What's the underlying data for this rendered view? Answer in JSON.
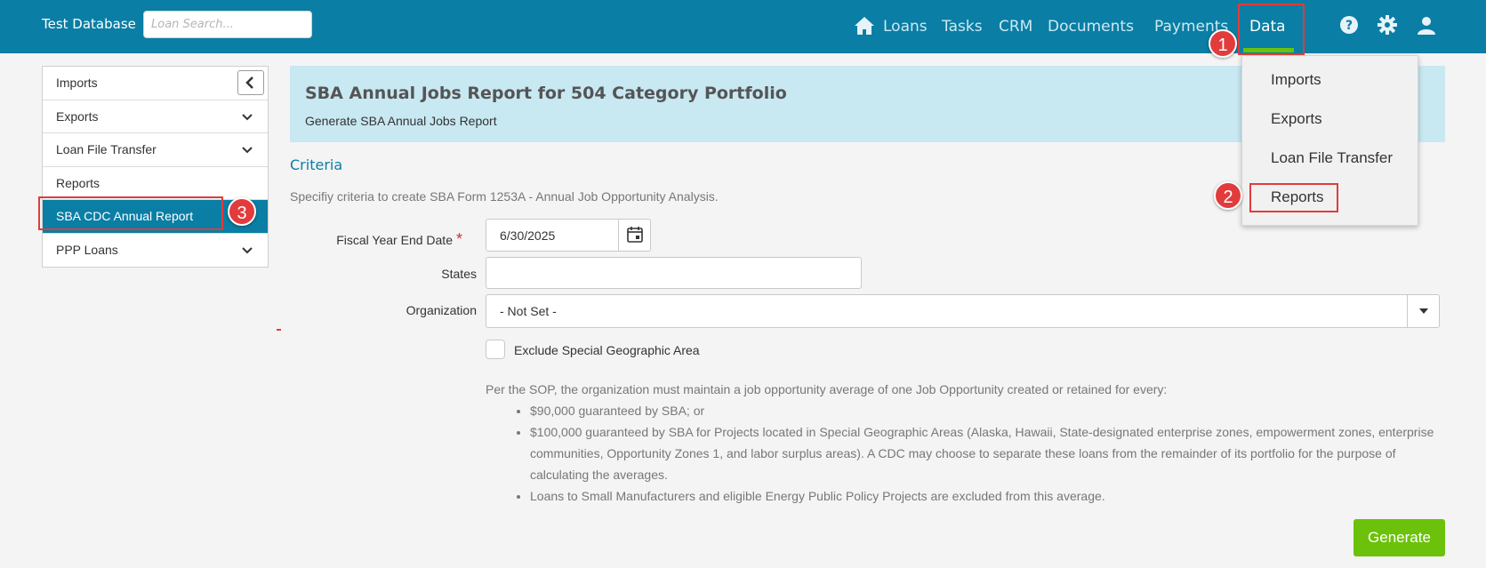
{
  "header": {
    "brand": "Test Database",
    "search_placeholder": "Loan Search...",
    "nav": [
      "Loans",
      "Tasks",
      "CRM",
      "Documents",
      "Payments",
      "Data"
    ],
    "active_nav": "Data",
    "icons": [
      "home-icon",
      "help-icon",
      "gear-icon",
      "user-icon"
    ],
    "accent_color": "#0a7ea4",
    "active_underline_color": "#6cc10a"
  },
  "sidebar": {
    "items": [
      {
        "label": "Imports",
        "icon": "collapse-left-icon"
      },
      {
        "label": "Exports",
        "icon": "chevron-down-icon"
      },
      {
        "label": "Loan File Transfer",
        "icon": "chevron-down-icon"
      },
      {
        "label": "Reports"
      },
      {
        "label": "SBA CDC Annual Report",
        "active": true
      },
      {
        "label": "PPP Loans",
        "icon": "chevron-down-icon"
      }
    ]
  },
  "main": {
    "title": "SBA Annual Jobs Report for 504 Category Portfolio",
    "subtitle": "Generate SBA Annual Jobs Report",
    "section": "Criteria",
    "intro": "Specifiy criteria to create SBA Form 1253A - Annual Job Opportunity Analysis.",
    "fields": {
      "fiscal_label": "Fiscal Year End Date",
      "fiscal_value": "6/30/2025",
      "states_label": "States",
      "states_value": "",
      "org_label": "Organization",
      "org_value": "- Not Set -",
      "exclude_label": "Exclude Special Geographic Area"
    },
    "sop_intro": "Per the SOP, the organization must maintain a job opportunity average of one Job Opportunity created or retained for every:",
    "sop_items": [
      "$90,000 guaranteed by SBA; or",
      "$100,000 guaranteed by SBA for Projects located in Special Geographic Areas (Alaska, Hawaii, State-designated enterprise zones, empowerment zones, enterprise communities, Opportunity Zones 1, and labor surplus areas). A CDC may choose to separate these loans from the remainder of its portfolio for the purpose of calculating the averages.",
      "Loans to Small Manufacturers and eligible Energy Public Policy Projects are excluded from this average."
    ],
    "generate_label": "Generate",
    "generate_color": "#6cc10a"
  },
  "dropdown": {
    "items": [
      "Imports",
      "Exports",
      "Loan File Transfer",
      "Reports"
    ]
  },
  "annotations": {
    "steps": [
      "1",
      "2",
      "3"
    ],
    "color": "#e23b3b"
  }
}
